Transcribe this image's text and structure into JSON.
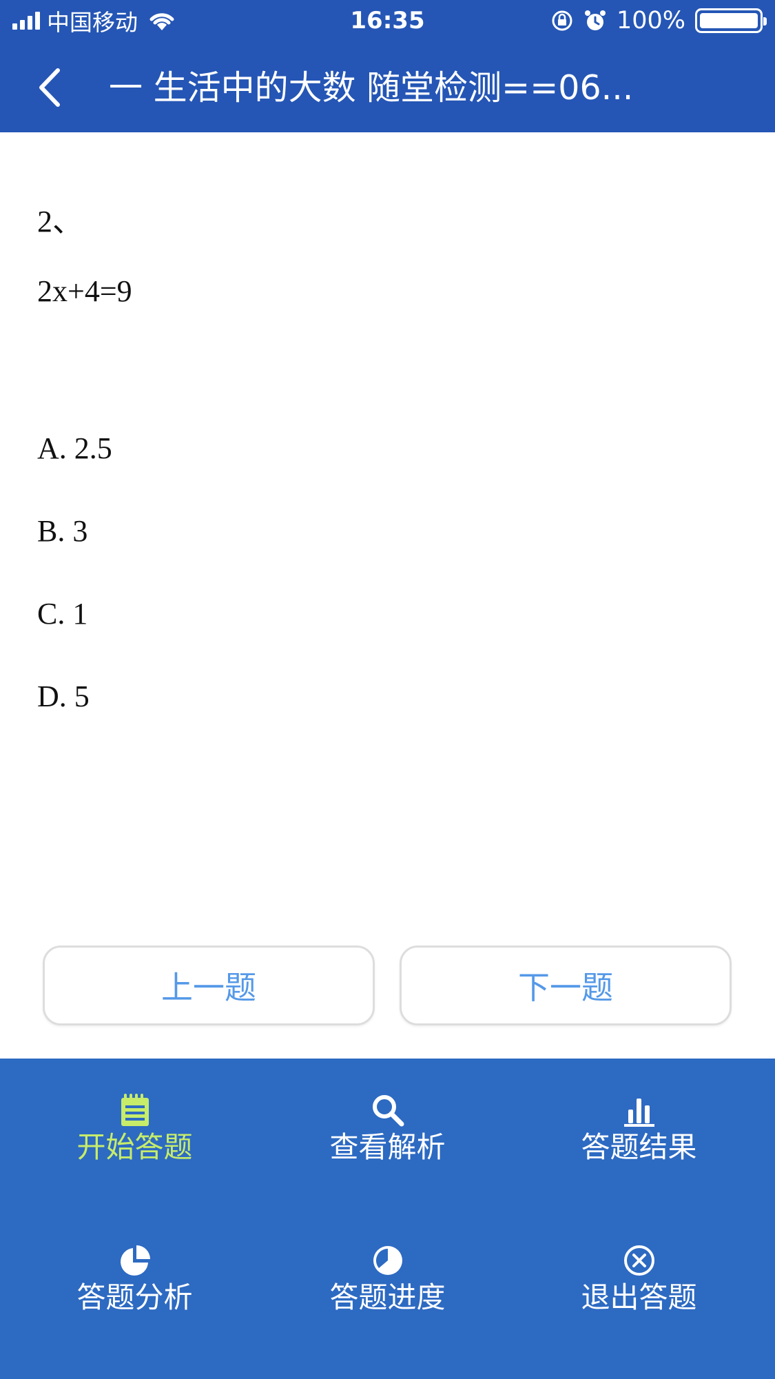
{
  "status_bar": {
    "carrier": "中国移动",
    "time": "16:35",
    "battery": "100%"
  },
  "nav": {
    "title": "一 生活中的大数 随堂检测==06..."
  },
  "question": {
    "number": "2、",
    "text": "2x+4=9",
    "options": [
      {
        "label": "A. 2.5"
      },
      {
        "label": "B. 3"
      },
      {
        "label": "C. 1"
      },
      {
        "label": "D. 5"
      }
    ]
  },
  "buttons": {
    "prev": "上一题",
    "next": "下一题"
  },
  "menu": {
    "items": [
      {
        "label": "开始答题",
        "icon": "notepad-icon",
        "active": true
      },
      {
        "label": "查看解析",
        "icon": "search-icon",
        "active": false
      },
      {
        "label": "答题结果",
        "icon": "bar-chart-icon",
        "active": false
      },
      {
        "label": "答题分析",
        "icon": "pie-chart-icon",
        "active": false
      },
      {
        "label": "答题进度",
        "icon": "progress-icon",
        "active": false
      },
      {
        "label": "退出答题",
        "icon": "close-circle-icon",
        "active": false
      }
    ],
    "colors": {
      "background": "#2d6ac2",
      "active": "#c6ec6a",
      "inactive": "#ffffff"
    }
  },
  "colors": {
    "header": "#2556b5",
    "button_text": "#5599e8"
  }
}
